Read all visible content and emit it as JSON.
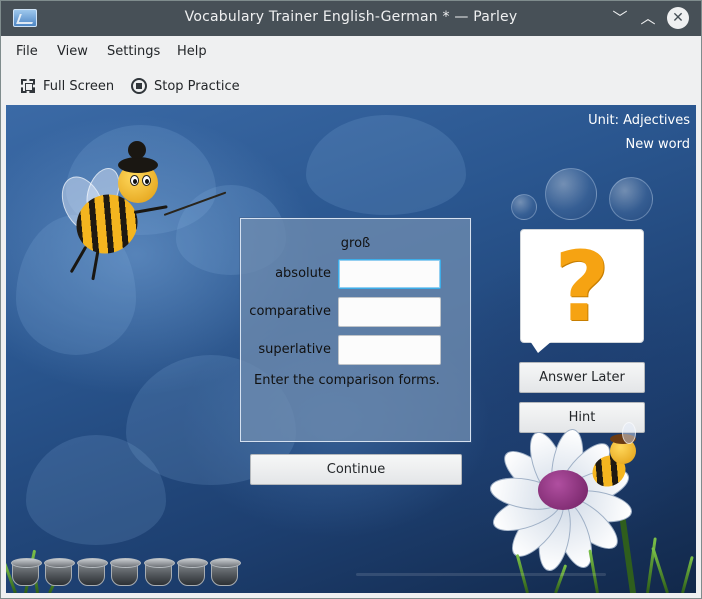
{
  "window": {
    "title": "Vocabulary Trainer English-German * — Parley",
    "controls": {
      "minimize": "﹀",
      "maximize": "︿",
      "close": "✕"
    }
  },
  "menu": [
    "File",
    "View",
    "Settings",
    "Help"
  ],
  "toolbar": {
    "full_screen": "Full Screen",
    "stop_practice": "Stop Practice"
  },
  "practice": {
    "unit": "Unit: Adjectives",
    "status": "New word",
    "question": "groß",
    "fields": [
      {
        "label": "absolute",
        "value": "",
        "focused": true
      },
      {
        "label": "comparative",
        "value": ""
      },
      {
        "label": "superlative",
        "value": ""
      }
    ],
    "instructions": "Enter the comparison forms.",
    "continue_label": "Continue",
    "answer_later_label": "Answer Later",
    "hint_label": "Hint",
    "hint_symbol": "?",
    "score_pots": 7
  },
  "colors": {
    "titlebar": "#475057",
    "background": "#eff0f1",
    "focus": "#3daee9",
    "hint_question_mark": "#f6a312"
  }
}
